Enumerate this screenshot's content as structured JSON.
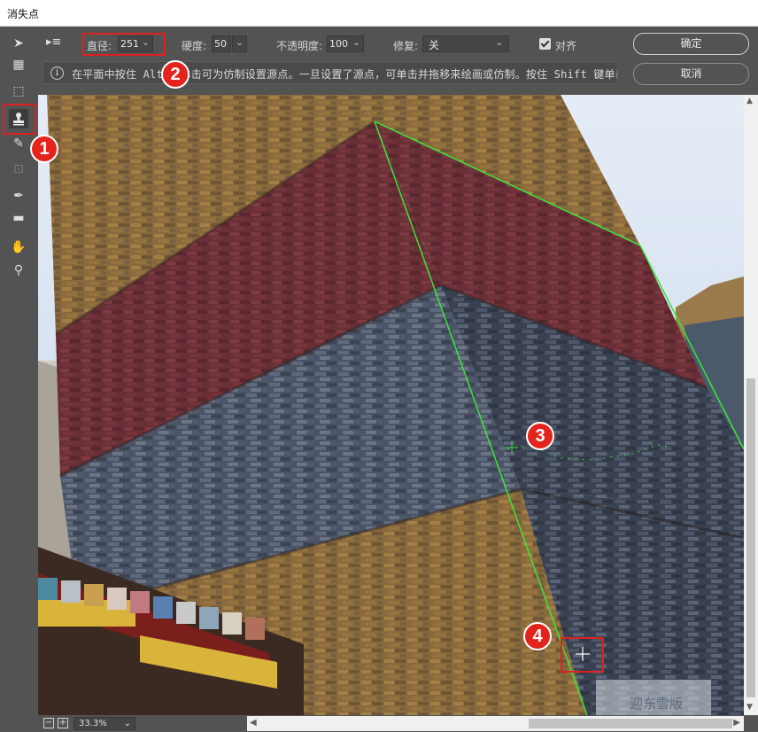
{
  "window": {
    "title": "消失点"
  },
  "options": {
    "diameter_label": "直径:",
    "diameter_value": "251",
    "hardness_label": "硬度:",
    "hardness_value": "50",
    "opacity_label": "不透明度:",
    "opacity_value": "100",
    "heal_label": "修复:",
    "heal_value": "关",
    "align_label": "对齐",
    "align_checked": true
  },
  "info": {
    "icon": "i",
    "text": "在平面中按住 Alt 键单击可为仿制设置源点。一旦设置了源点，可单击并拖移来绘画或仿制。按住 Shift 键单击可"
  },
  "buttons": {
    "ok": "确定",
    "cancel": "取消"
  },
  "tools": [
    {
      "name": "edit-plane-icon",
      "glyph": "➤"
    },
    {
      "name": "create-plane-icon",
      "glyph": "▦"
    },
    {
      "name": "marquee-icon",
      "glyph": "⬚"
    },
    {
      "name": "stamp-icon",
      "glyph": "⬆"
    },
    {
      "name": "brush-icon",
      "glyph": "✎"
    },
    {
      "name": "transform-icon",
      "glyph": "⊡"
    },
    {
      "name": "eyedropper-icon",
      "glyph": "✒"
    },
    {
      "name": "ruler-icon",
      "glyph": "▬"
    },
    {
      "name": "hand-icon",
      "glyph": "✋"
    },
    {
      "name": "zoom-icon",
      "glyph": "⚲"
    }
  ],
  "zoom": {
    "value": "33.3%",
    "minus": "−",
    "plus": "+"
  },
  "markers": [
    "1",
    "2",
    "3",
    "4"
  ],
  "watermark": "迎东雪版",
  "colors": {
    "panel": "#535353",
    "plane_grid": "#39e63a",
    "highlight": "#e02020",
    "marker": "#e4231c"
  }
}
